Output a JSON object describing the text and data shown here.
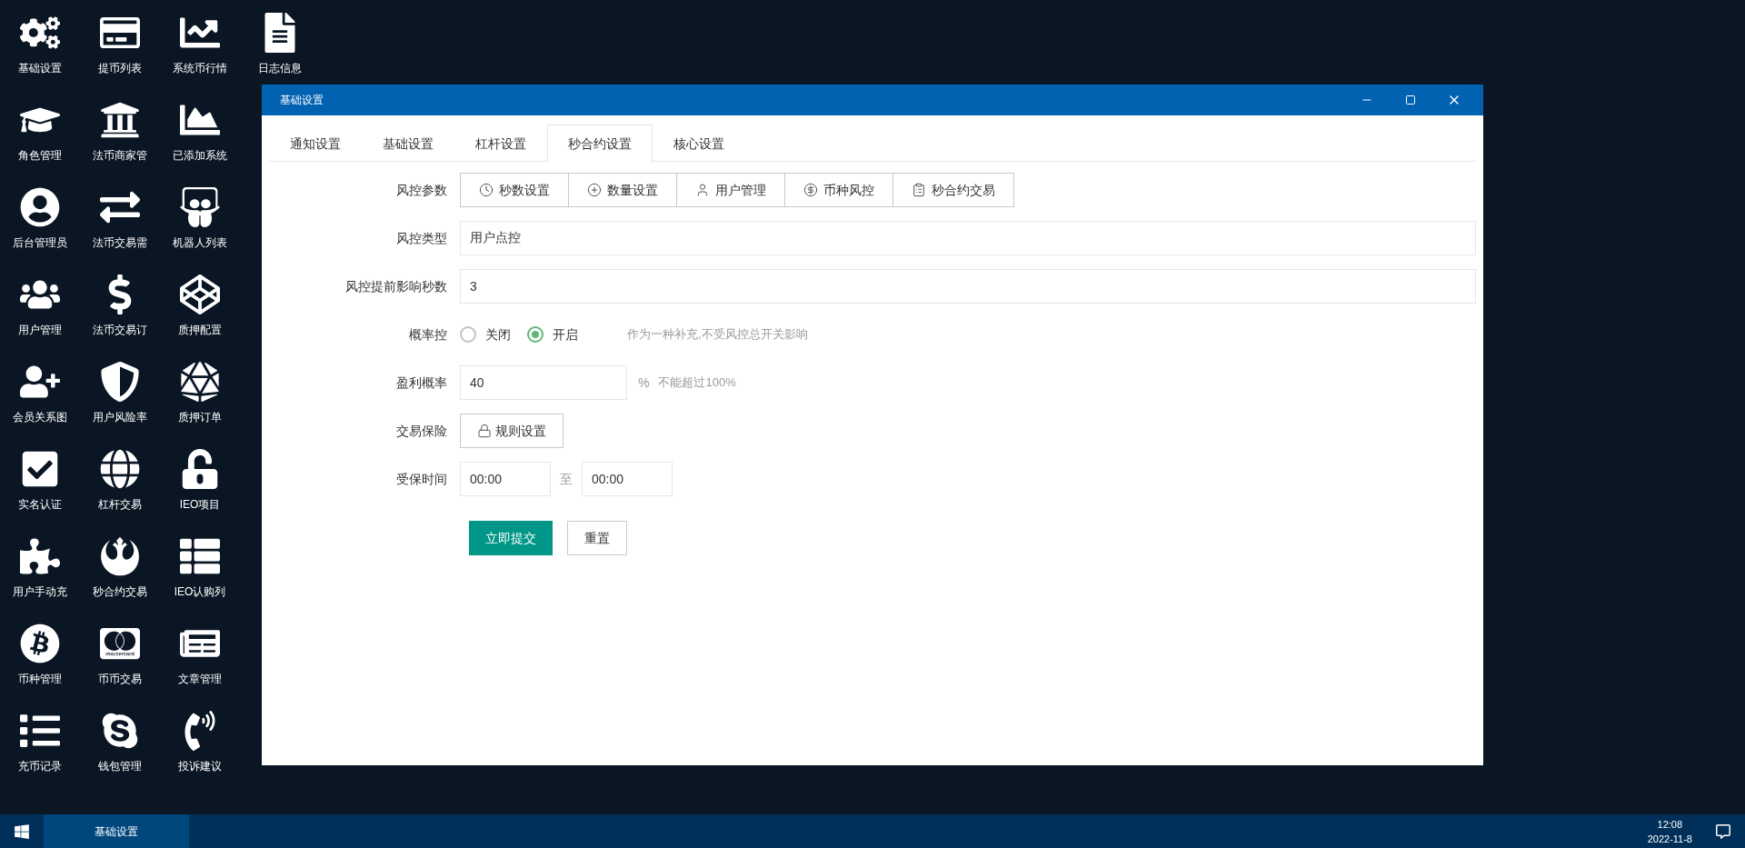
{
  "desktop": {
    "columns": [
      [
        {
          "label": "基础设置"
        },
        {
          "label": "角色管理"
        },
        {
          "label": "后台管理员"
        },
        {
          "label": "用户管理"
        },
        {
          "label": "会员关系图"
        },
        {
          "label": "实名认证"
        },
        {
          "label": "用户手动充"
        },
        {
          "label": "币种管理"
        },
        {
          "label": "充币记录"
        }
      ],
      [
        {
          "label": "提币列表"
        },
        {
          "label": "法币商家管"
        },
        {
          "label": "法币交易需"
        },
        {
          "label": "法币交易订"
        },
        {
          "label": "用户风险率"
        },
        {
          "label": "杠杆交易"
        },
        {
          "label": "秒合约交易"
        },
        {
          "label": "币币交易"
        },
        {
          "label": "钱包管理"
        }
      ],
      [
        {
          "label": "系统币行情"
        },
        {
          "label": "已添加系统"
        },
        {
          "label": "机器人列表"
        },
        {
          "label": "质押配置"
        },
        {
          "label": "质押订单"
        },
        {
          "label": "IEO项目"
        },
        {
          "label": "IEO认购列"
        },
        {
          "label": "文章管理"
        },
        {
          "label": "投诉建议"
        }
      ],
      [
        {
          "label": "日志信息"
        }
      ]
    ]
  },
  "window": {
    "title": "基础设置",
    "tabs": [
      {
        "label": "通知设置",
        "selected": false
      },
      {
        "label": "基础设置",
        "selected": false
      },
      {
        "label": "杠杆设置",
        "selected": false
      },
      {
        "label": "秒合约设置",
        "selected": true
      },
      {
        "label": "核心设置",
        "selected": false
      }
    ],
    "form": [
      {
        "kind": "buttons",
        "label": "风控参数",
        "buttons": [
          "秒数设置",
          "数量设置",
          "用户管理",
          "币种风控",
          "秒合约交易"
        ]
      },
      {
        "kind": "text",
        "label": "风控类型",
        "value": "用户点控"
      },
      {
        "kind": "text",
        "label": "风控提前影响秒数",
        "value": "3"
      },
      {
        "kind": "radio",
        "label": "概率控",
        "options": [
          {
            "label": "关闭",
            "selected": false
          },
          {
            "label": "开启",
            "selected": true
          }
        ],
        "hint": "作为一种补充,不受风控总开关影响"
      },
      {
        "kind": "percent",
        "label": "盈利概率",
        "value": "40",
        "unit": "%",
        "hint": "不能超过100%"
      },
      {
        "kind": "button",
        "label": "交易保险",
        "button": "规则设置"
      },
      {
        "kind": "time_range",
        "label": "受保时间",
        "from": "00:00",
        "separator": "至",
        "to": "00:00"
      }
    ],
    "actions": [
      {
        "label": "立即提交",
        "kind": "primary"
      },
      {
        "label": "重置",
        "kind": "default"
      }
    ]
  },
  "taskbar": {
    "tasks": [
      {
        "label": "基础设置",
        "selected": true
      }
    ],
    "time": "12:08",
    "date": "2022-11-8"
  }
}
